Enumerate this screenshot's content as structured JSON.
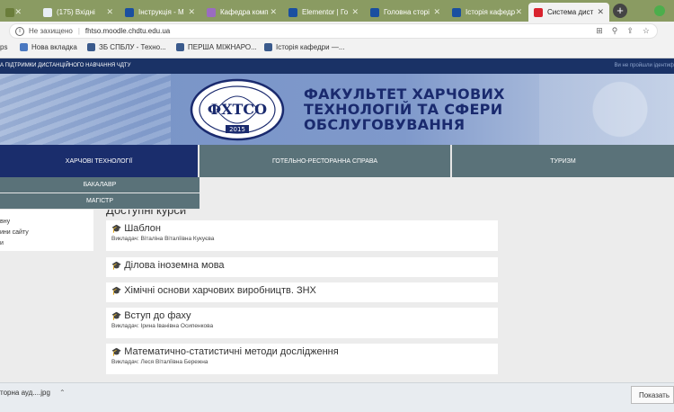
{
  "browser": {
    "tabs": [
      {
        "label": "",
        "color": "#6a7d3a",
        "active": false
      },
      {
        "label": "(175) Вхідні",
        "color": "#e8eef5",
        "active": false
      },
      {
        "label": "Інструкція - М",
        "color": "#1a4fa0",
        "active": false
      },
      {
        "label": "Кафедра комп",
        "color": "#9a6cc0",
        "active": false
      },
      {
        "label": "Elementor | Го",
        "color": "#1a4fa0",
        "active": false
      },
      {
        "label": "Головна сторі",
        "color": "#1a4fa0",
        "active": false
      },
      {
        "label": "Історія кафедр",
        "color": "#1a4fa0",
        "active": false
      },
      {
        "label": "Система дист",
        "color": "#d9232e",
        "active": true
      }
    ],
    "new_tab_label": "+",
    "security_label": "Не захищено",
    "url": "fhtso.moodle.chdtu.edu.ua",
    "bookmarks": [
      {
        "label": "ps",
        "color": "#666"
      },
      {
        "label": "Нова вкладка",
        "color": "#4a78c0"
      },
      {
        "label": "ЗБ СПБЛУ - Техно...",
        "color": "#3a5a8c"
      },
      {
        "label": "ПЕРША МІЖНАРО...",
        "color": "#3a5a8c"
      },
      {
        "label": "Історія кафедри —...",
        "color": "#3a5a8c"
      }
    ]
  },
  "site": {
    "top_strip_left": "А ПІДТРИМКИ ДИСТАНЦІЙНОГО НАВЧАННЯ ЧДТУ",
    "top_strip_right": "Ви не пройшли ідентиф",
    "faculty_lines": [
      "ФАКУЛЬТЕТ ХАРЧОВИХ",
      "ТЕХНОЛОГІЙ ТА СФЕРИ",
      "ОБСЛУГОВУВАННЯ"
    ],
    "logo": {
      "letters": "ФХТСО",
      "year": "2015"
    },
    "nav": [
      "ХАРЧОВІ ТЕХНОЛОГІЇ",
      "ГОТЕЛЬНО-РЕСТОРАННА СПРАВА",
      "ТУРИЗМ"
    ],
    "dropdown": [
      "БАКАЛАВР",
      "МАГІСТР"
    ],
    "side_items": [
      "вну",
      "ини сайту",
      "и"
    ],
    "section_title": "Доступні курси",
    "courses": [
      {
        "title": "Шаблон",
        "teacher": "Викладач: Віталіна Віталіївна Кукуєва"
      },
      {
        "title": "Ділова іноземна мова",
        "teacher": ""
      },
      {
        "title": "Хімічні основи харчових виробництв. ЗНХ",
        "teacher": ""
      },
      {
        "title": "Вступ до фаху",
        "teacher": "Викладач: Ірина Іванівна Осипенкова"
      },
      {
        "title": "Математично-статистичні методи дослідження",
        "teacher": "Викладач: Леся Віталіївна Бережна"
      }
    ]
  },
  "downloads": {
    "item": "торна ауд....jpg",
    "show_all": "Показать"
  },
  "colors": {
    "tabbar": "#8a9b62",
    "topstrip": "#1a3266",
    "nav": "#5a7279",
    "nav_active": "#1a2d6c",
    "faculty_text": "#1a2a6e"
  }
}
